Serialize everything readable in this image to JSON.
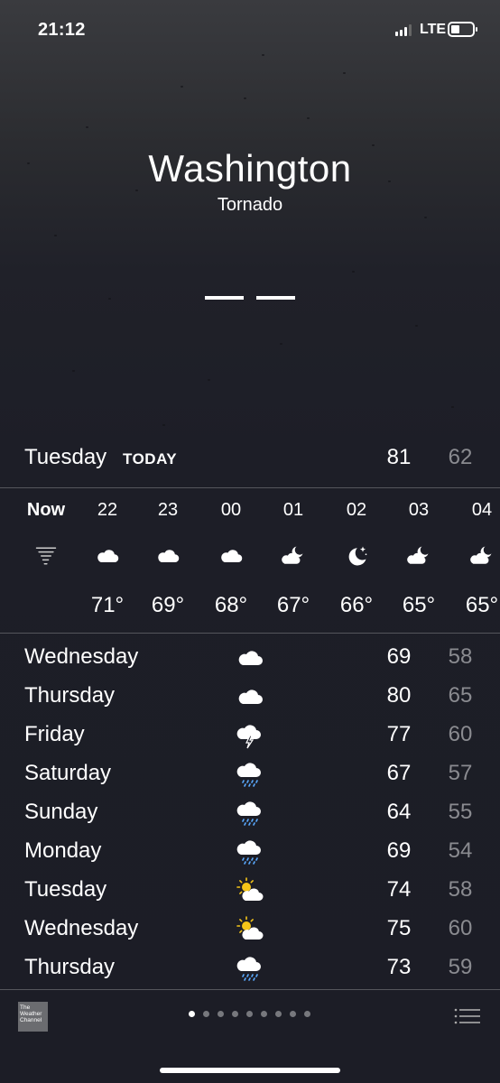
{
  "status_bar": {
    "time": "21:12",
    "network": "LTE"
  },
  "location": {
    "city": "Washington",
    "condition": "Tornado",
    "current_temp": "— —"
  },
  "today": {
    "day": "Tuesday",
    "label": "TODAY",
    "high": "81",
    "low": "62"
  },
  "hourly": [
    {
      "time": "Now",
      "icon": "tornado-icon",
      "temp": ""
    },
    {
      "time": "22",
      "icon": "cloud-icon",
      "temp": "71°"
    },
    {
      "time": "23",
      "icon": "cloud-icon",
      "temp": "69°"
    },
    {
      "time": "00",
      "icon": "cloud-icon",
      "temp": "68°"
    },
    {
      "time": "01",
      "icon": "cloud-moon-icon",
      "temp": "67°"
    },
    {
      "time": "02",
      "icon": "moon-stars-icon",
      "temp": "66°"
    },
    {
      "time": "03",
      "icon": "cloud-moon-icon",
      "temp": "65°"
    },
    {
      "time": "04",
      "icon": "cloud-moon-icon",
      "temp": "65°"
    }
  ],
  "daily": [
    {
      "day": "Wednesday",
      "icon": "cloud-icon",
      "high": "69",
      "low": "58"
    },
    {
      "day": "Thursday",
      "icon": "cloud-icon",
      "high": "80",
      "low": "65"
    },
    {
      "day": "Friday",
      "icon": "thunderstorm-icon",
      "high": "77",
      "low": "60"
    },
    {
      "day": "Saturday",
      "icon": "rain-icon",
      "high": "67",
      "low": "57"
    },
    {
      "day": "Sunday",
      "icon": "rain-icon",
      "high": "64",
      "low": "55"
    },
    {
      "day": "Monday",
      "icon": "rain-icon",
      "high": "69",
      "low": "54"
    },
    {
      "day": "Tuesday",
      "icon": "partly-sunny-icon",
      "high": "74",
      "low": "58"
    },
    {
      "day": "Wednesday",
      "icon": "partly-sunny-icon",
      "high": "75",
      "low": "60"
    },
    {
      "day": "Thursday",
      "icon": "rain-icon",
      "high": "73",
      "low": "59"
    }
  ],
  "footer": {
    "logo_lines": [
      "The",
      "Weather",
      "Channel"
    ],
    "page_count": 9,
    "active_page": 0
  },
  "colors": {
    "low_temp": "#8a8b90",
    "rain_drops": "#5aa9ff",
    "sun": "#f5c518"
  }
}
